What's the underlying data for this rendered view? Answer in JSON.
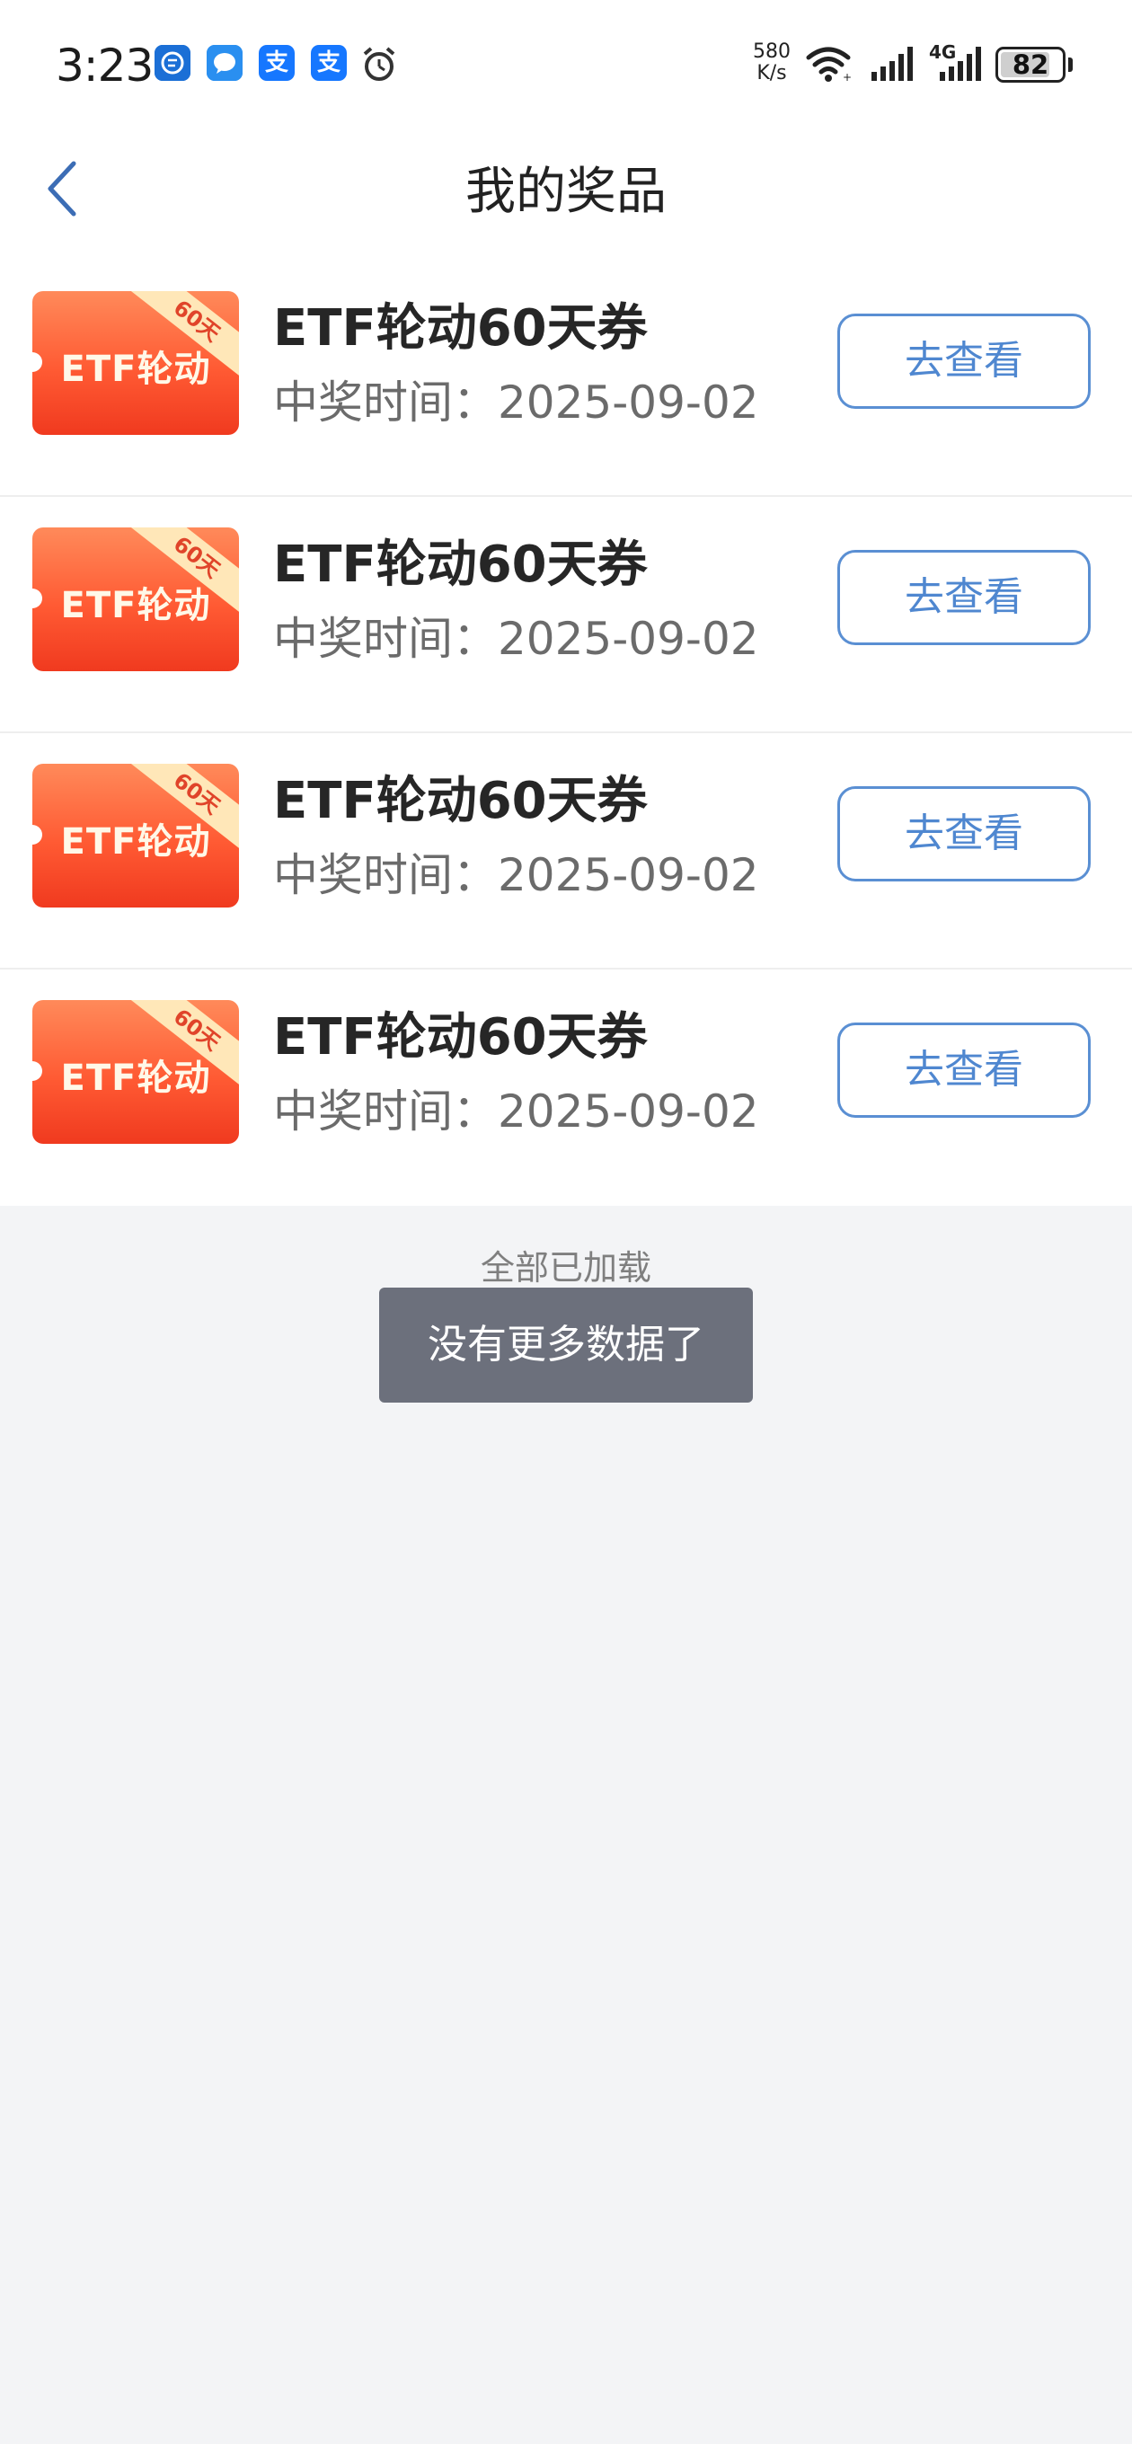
{
  "status_bar": {
    "time": "3:23",
    "network_speed_value": "580",
    "network_speed_unit": "K/s",
    "network_type": "4G",
    "battery": "82",
    "battery_level": 0.82,
    "app_icons": [
      {
        "icon": "message-app-icon",
        "glyph": "◉",
        "color": "#1b6fd6"
      },
      {
        "icon": "chat-bubble-app-icon",
        "glyph": "●",
        "color": "#2a8ff0"
      },
      {
        "icon": "alipay-app-icon",
        "glyph": "支",
        "color": "#1677ff"
      },
      {
        "icon": "alipay-app-icon",
        "glyph": "支",
        "color": "#1677ff"
      },
      {
        "icon": "alarm-clock-icon",
        "glyph": "⏰",
        "color": "#333333"
      }
    ]
  },
  "nav": {
    "title": "我的奖品"
  },
  "prizes": [
    {
      "coupon_label": "ETF轮动",
      "coupon_ribbon": "60天",
      "name": "ETF轮动60天券",
      "time": "中奖时间：2025-09-02",
      "button": "去查看"
    },
    {
      "coupon_label": "ETF轮动",
      "coupon_ribbon": "60天",
      "name": "ETF轮动60天券",
      "time": "中奖时间：2025-09-02",
      "button": "去查看"
    },
    {
      "coupon_label": "ETF轮动",
      "coupon_ribbon": "60天",
      "name": "ETF轮动60天券",
      "time": "中奖时间：2025-09-02",
      "button": "去查看"
    },
    {
      "coupon_label": "ETF轮动",
      "coupon_ribbon": "60天",
      "name": "ETF轮动60天券",
      "time": "中奖时间：2025-09-02",
      "button": "去查看"
    }
  ],
  "footer": {
    "loaded_text": "全部已加载",
    "toast": "没有更多数据了"
  },
  "colors": {
    "accent_blue": "#4f87d0",
    "coupon_red": "#f03a1f",
    "page_background": "#f3f4f6"
  }
}
